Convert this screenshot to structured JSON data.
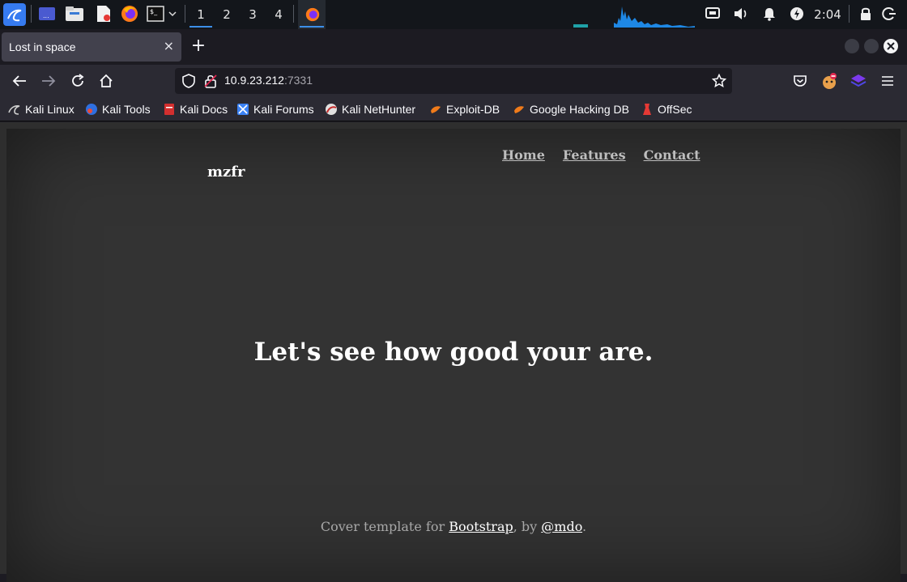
{
  "taskbar": {
    "workspaces": [
      "1",
      "2",
      "3",
      "4"
    ],
    "active_workspace": "1",
    "clock": "2:04",
    "icons": [
      "kali-menu-icon",
      "show-desktop-icon",
      "file-manager-icon",
      "text-editor-icon",
      "firefox-icon",
      "terminal-icon",
      "chevron-down-icon",
      "network-icon",
      "volume-icon",
      "notifications-icon",
      "power-manager-icon",
      "lock-icon",
      "logout-icon"
    ],
    "accent": "#3c8fe8"
  },
  "browser": {
    "tab_title": "Lost in space",
    "tab_close": "×",
    "new_tab": "+",
    "url_host": "10.9.23.212",
    "url_port": ":7331",
    "bookmarks": [
      "Kali Linux",
      "Kali Tools",
      "Kali Docs",
      "Kali Forums",
      "Kali NetHunter",
      "Exploit-DB",
      "Google Hacking DB",
      "OffSec"
    ]
  },
  "page": {
    "brand": "mzfr",
    "nav": [
      "Home",
      "Features",
      "Contact"
    ],
    "headline": "Let's see how good your are.",
    "footer_prefix": "Cover template for ",
    "footer_link1": "Bootstrap",
    "footer_mid": ", by ",
    "footer_link2": "@mdo",
    "footer_suffix": "."
  }
}
